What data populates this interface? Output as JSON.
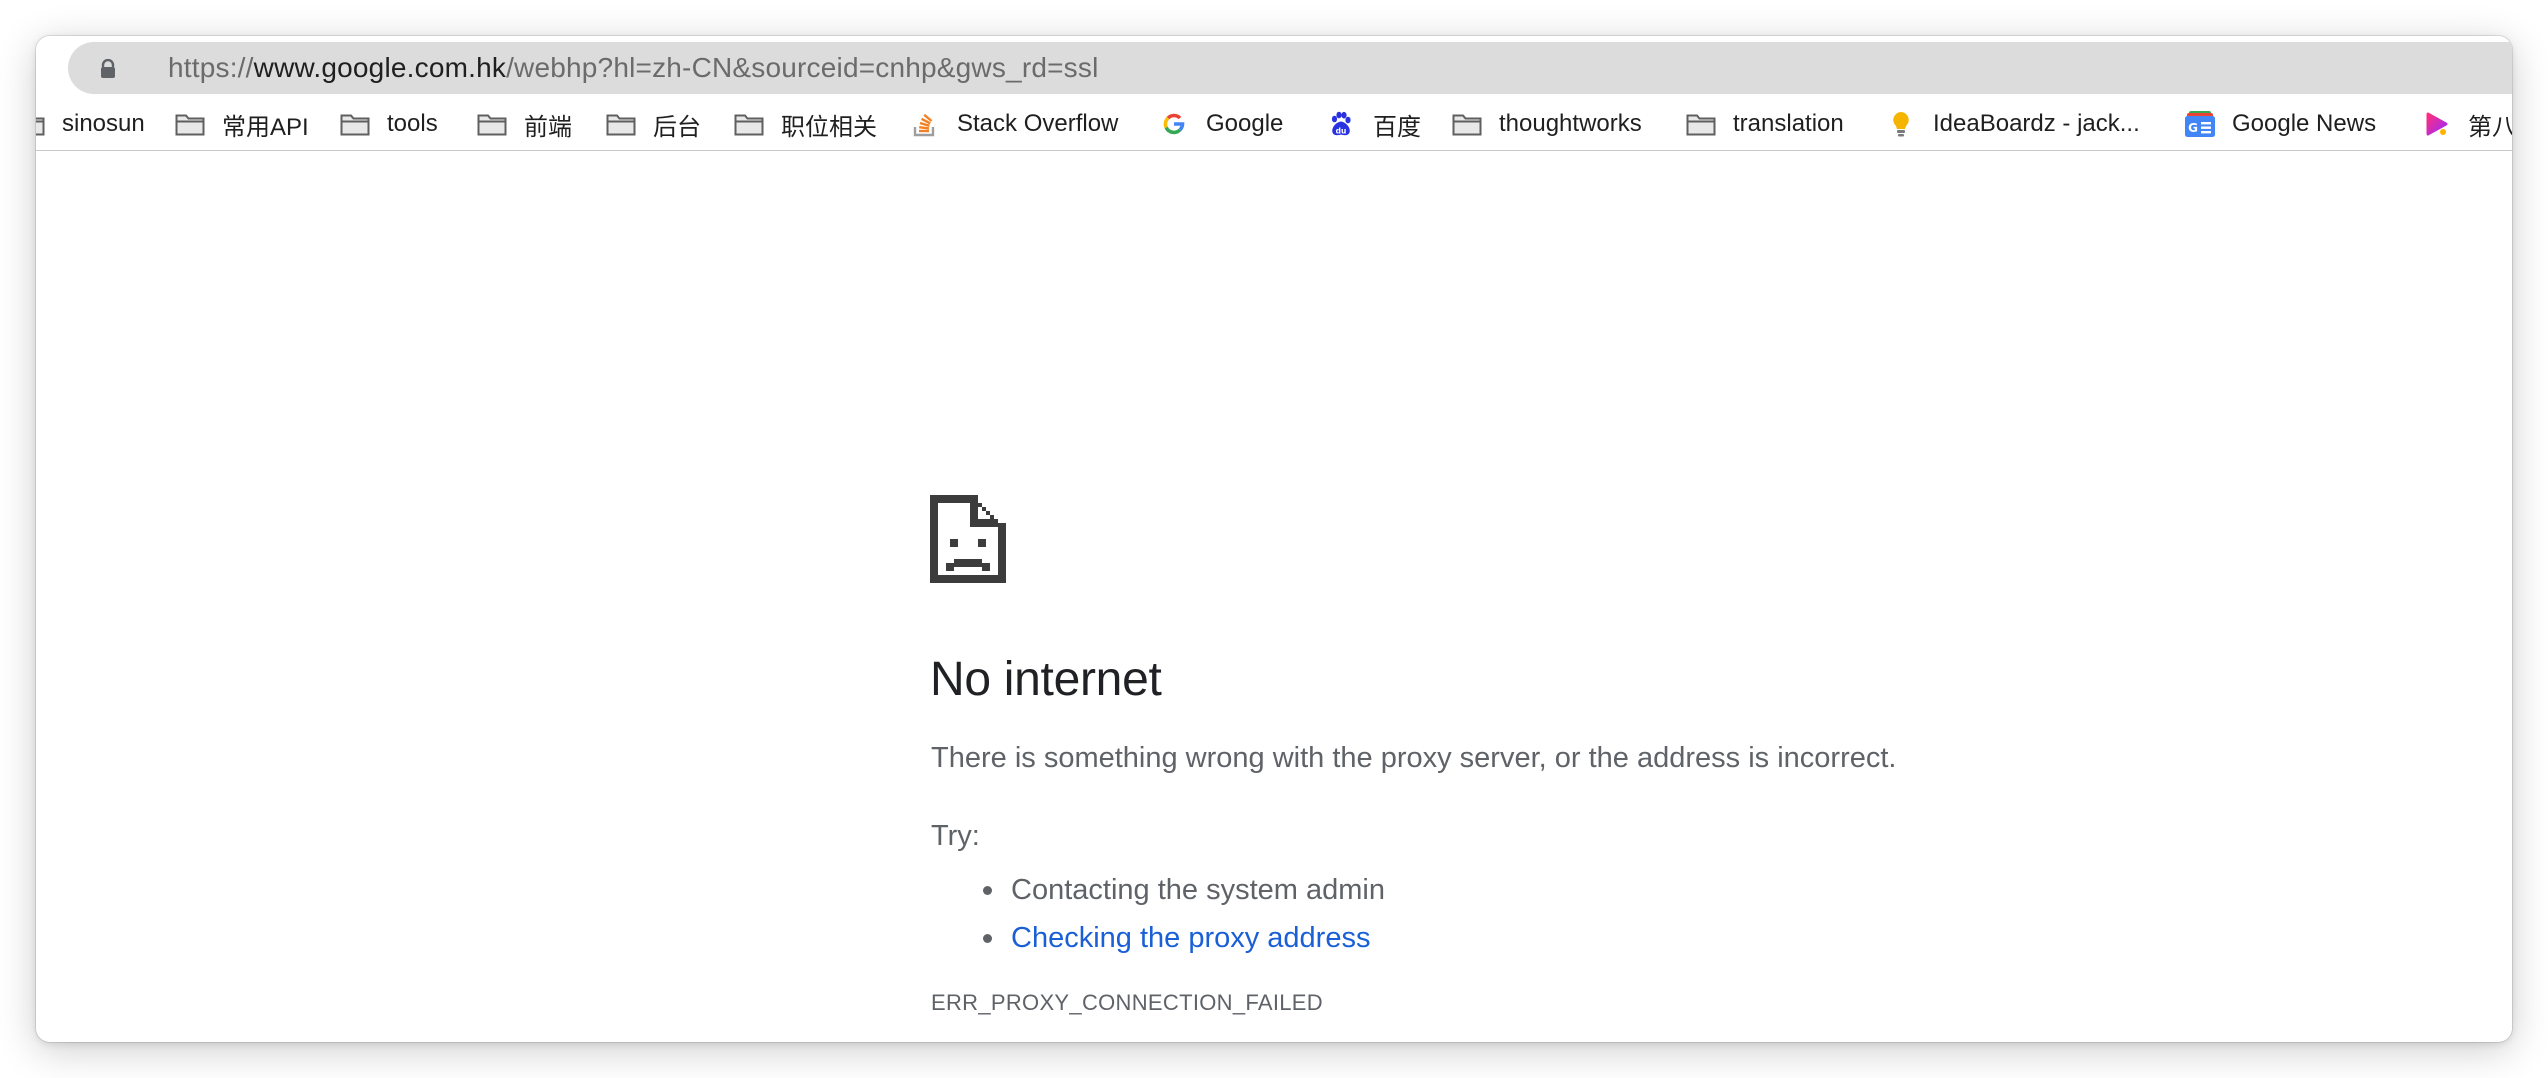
{
  "browser": {
    "url": {
      "scheme": "https://",
      "host": "www.google.com.hk",
      "rest": "/webhp?hl=zh-CN&sourceid=cnhp&gws_rd=ssl"
    },
    "bookmarks": [
      {
        "label": "sinosun",
        "icon": "folder-icon"
      },
      {
        "label": "常用API",
        "icon": "folder-icon"
      },
      {
        "label": "tools",
        "icon": "folder-icon"
      },
      {
        "label": "前端",
        "icon": "folder-icon"
      },
      {
        "label": "后台",
        "icon": "folder-icon"
      },
      {
        "label": "职位相关",
        "icon": "folder-icon"
      },
      {
        "label": "Stack Overflow",
        "icon": "stackoverflow-icon"
      },
      {
        "label": "Google",
        "icon": "google-icon"
      },
      {
        "label": "百度",
        "icon": "baidu-icon"
      },
      {
        "label": "thoughtworks",
        "icon": "folder-icon"
      },
      {
        "label": "translation",
        "icon": "folder-icon"
      },
      {
        "label": "IdeaBoardz - jack...",
        "icon": "lightbulb-icon"
      },
      {
        "label": "Google News",
        "icon": "google-news-icon"
      },
      {
        "label": "第八",
        "icon": "play-icon"
      }
    ]
  },
  "error_page": {
    "icon": "sad-page-icon",
    "headline": "No internet",
    "description": "There is something wrong with the proxy server, or the address is incorrect.",
    "try_label": "Try:",
    "suggestions": [
      {
        "text": "Contacting the system admin",
        "link": false
      },
      {
        "text": "Checking the proxy address",
        "link": true
      }
    ],
    "error_code": "ERR_PROXY_CONNECTION_FAILED"
  },
  "colors": {
    "link": "#1a5fd6",
    "text": "#5f6368",
    "headline": "#202124",
    "omnibox": "#dcdcdc"
  }
}
